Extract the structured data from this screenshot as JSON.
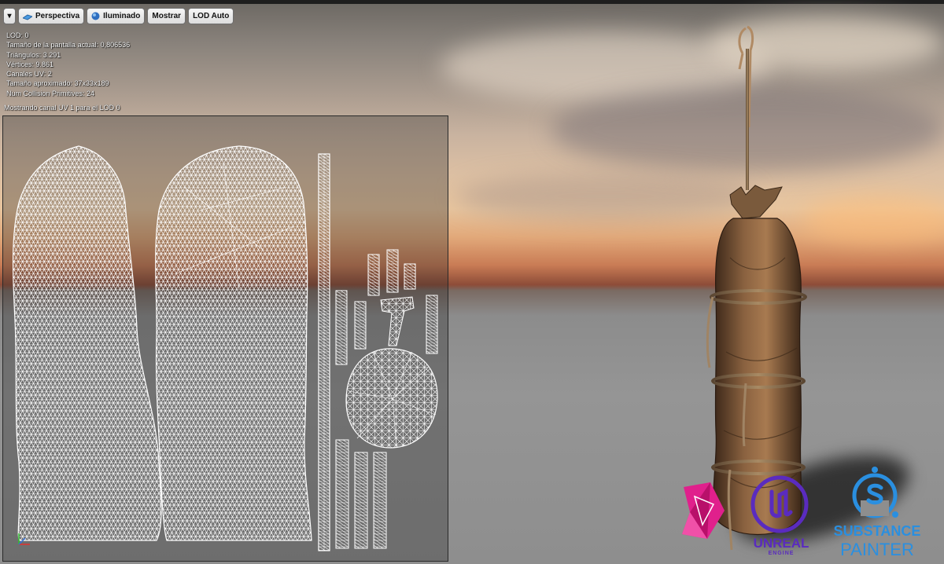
{
  "toolbar": {
    "dropdown_label": "▾",
    "perspective_label": "Perspectiva",
    "lit_label": "Iluminado",
    "show_label": "Mostrar",
    "lod_label": "LOD Auto"
  },
  "stats": [
    "LOD:  0",
    "Tamaño de la pantalla actual: 0,806536",
    "Triángulos: 3.291",
    "Vértices: 9.861",
    "Canales UV: 2",
    "Tamaño aproximado: 37x33x189",
    "Num Collision Primitives:  24"
  ],
  "uv_caption": "Mostrando canal UV 1 para el LOD 0",
  "logos": {
    "unreal": {
      "name": "UNREAL",
      "sub": "ENGINE"
    },
    "substance": {
      "line1": "SUBSTANCE",
      "line2": "PAINTER"
    }
  },
  "colors": {
    "wire": "#ffffff",
    "substance_blue": "#2a8fe0",
    "unreal_purple": "#5a2bbf",
    "pink_logo": "#e0208c"
  }
}
